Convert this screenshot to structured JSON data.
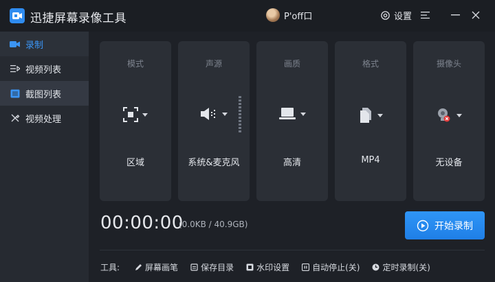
{
  "app": {
    "title": "迅捷屏幕录像工具",
    "user_name": "P'off口",
    "settings_label": "设置"
  },
  "colors": {
    "accent": "#2f8cf0",
    "background": "#1e2127",
    "card": "#2b2f36"
  },
  "sidebar": {
    "items": [
      {
        "label": "录制",
        "icon": "video-camera-icon"
      },
      {
        "label": "视频列表",
        "icon": "list-icon"
      },
      {
        "label": "截图列表",
        "icon": "image-icon"
      },
      {
        "label": "视频处理",
        "icon": "tools-icon"
      }
    ]
  },
  "options": [
    {
      "label": "模式",
      "value": "区域",
      "icon": "region-select-icon"
    },
    {
      "label": "声源",
      "value": "系统&麦克风",
      "icon": "speaker-icon"
    },
    {
      "label": "画质",
      "value": "高清",
      "icon": "monitor-icon"
    },
    {
      "label": "格式",
      "value": "MP4",
      "icon": "file-icon"
    },
    {
      "label": "摄像头",
      "value": "无设备",
      "icon": "webcam-off-icon"
    }
  ],
  "status": {
    "timer": "00:00:00",
    "size": "(0.0KB / 40.9GB)"
  },
  "start_button": {
    "label": "开始录制"
  },
  "tools": {
    "label": "工具:",
    "items": [
      {
        "label": "屏幕画笔",
        "icon": "pen-icon"
      },
      {
        "label": "保存目录",
        "icon": "folder-icon"
      },
      {
        "label": "水印设置",
        "icon": "watermark-icon"
      },
      {
        "label": "自动停止(关)",
        "icon": "auto-stop-icon"
      },
      {
        "label": "定时录制(关)",
        "icon": "clock-icon"
      }
    ]
  }
}
